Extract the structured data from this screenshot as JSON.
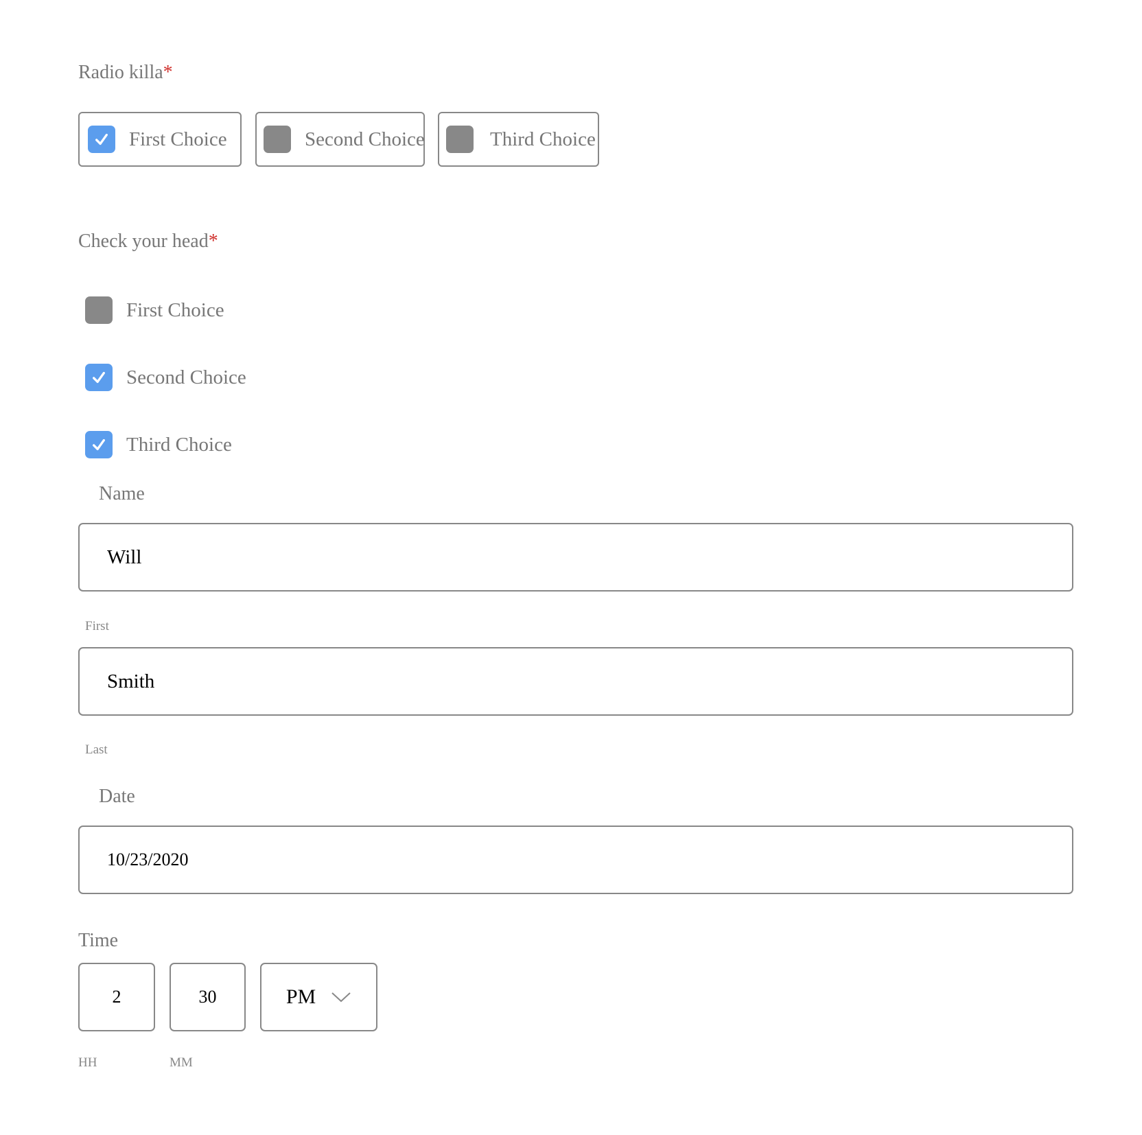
{
  "radio_group": {
    "label": "Radio killa",
    "required_mark": "*",
    "options": [
      {
        "label": "First Choice",
        "selected": true
      },
      {
        "label": "Second Choice",
        "selected": false
      },
      {
        "label": "Third Choice",
        "selected": false
      }
    ]
  },
  "checkbox_group": {
    "label": "Check your head",
    "required_mark": "*",
    "options": [
      {
        "label": "First Choice",
        "checked": false
      },
      {
        "label": "Second Choice",
        "checked": true
      },
      {
        "label": "Third Choice",
        "checked": true
      }
    ]
  },
  "name": {
    "label": "Name",
    "first_value": "Will",
    "first_sublabel": "First",
    "last_value": "Smith",
    "last_sublabel": "Last"
  },
  "date": {
    "label": "Date",
    "value": "10/23/2020"
  },
  "time": {
    "label": "Time",
    "hour_value": "2",
    "hour_sublabel": "HH",
    "minute_value": "30",
    "minute_sublabel": "MM",
    "period_value": "PM"
  },
  "colors": {
    "checked": "#5b9ded",
    "unchecked": "#888888",
    "required": "#d0312d"
  }
}
